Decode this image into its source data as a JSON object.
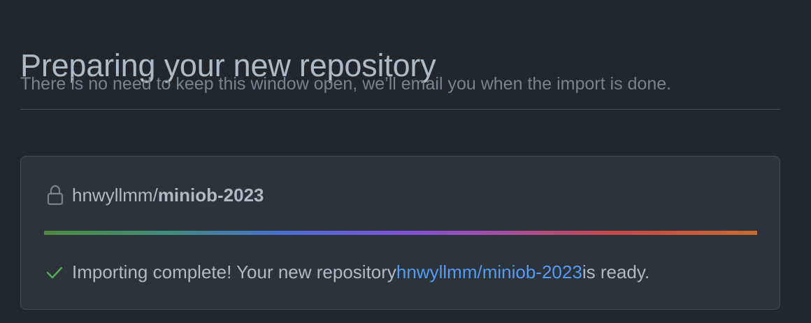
{
  "header": {
    "title": "Preparing your new repository",
    "subtitle": "There is no need to keep this window open, we’ll email you when the import is done."
  },
  "repository": {
    "owner": "hnwyllmm",
    "separator": "/",
    "name": "miniob-2023",
    "visibility_icon": "lock-icon"
  },
  "progress": {
    "percent": 100
  },
  "status": {
    "icon": "check-icon",
    "prefix": "Importing complete! Your new repository ",
    "link_text": "hnwyllmm/miniob-2023",
    "suffix": " is ready."
  },
  "colors": {
    "background": "#22272e",
    "card": "#2d333b",
    "border": "#444c56",
    "text": "#adbac7",
    "muted": "#768390",
    "link": "#539bf5",
    "success": "#57ab5a"
  }
}
